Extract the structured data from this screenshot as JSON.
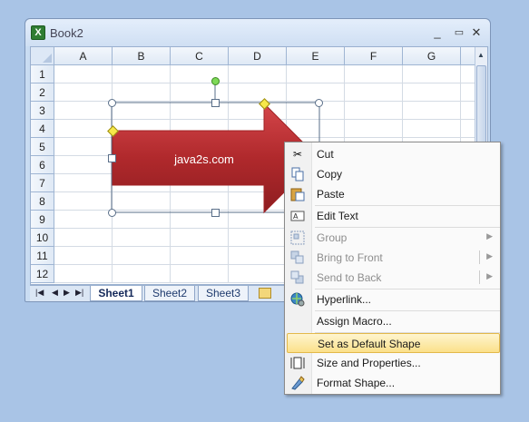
{
  "window": {
    "title": "Book2",
    "minimize": "_",
    "restore": "▭",
    "close": "✕"
  },
  "columns": [
    "A",
    "B",
    "C",
    "D",
    "E",
    "F",
    "G"
  ],
  "rows": [
    "1",
    "2",
    "3",
    "4",
    "5",
    "6",
    "7",
    "8",
    "9",
    "10",
    "11",
    "12"
  ],
  "sheets": {
    "tabs": [
      "Sheet1",
      "Sheet2",
      "Sheet3"
    ],
    "active": "Sheet1"
  },
  "shape": {
    "text": "java2s.com",
    "fill": "#b0292c"
  },
  "menu": {
    "items": [
      {
        "label": "Cut",
        "icon": "scissors-icon",
        "disabled": false
      },
      {
        "label": "Copy",
        "icon": "copy-icon",
        "disabled": false
      },
      {
        "label": "Paste",
        "icon": "paste-icon",
        "disabled": false
      },
      {
        "label": "Edit Text",
        "icon": "edit-text-icon",
        "disabled": false
      },
      {
        "label": "Group",
        "icon": "group-icon",
        "disabled": true
      },
      {
        "label": "Bring to Front",
        "icon": "bring-front-icon",
        "disabled": true
      },
      {
        "label": "Send to Back",
        "icon": "send-back-icon",
        "disabled": true
      },
      {
        "label": "Hyperlink...",
        "icon": "hyperlink-icon",
        "disabled": false
      },
      {
        "label": "Assign Macro...",
        "icon": "",
        "disabled": false
      },
      {
        "label": "Set as Default Shape",
        "icon": "",
        "disabled": false,
        "highlighted": true
      },
      {
        "label": "Size and Properties...",
        "icon": "size-properties-icon",
        "disabled": false
      },
      {
        "label": "Format Shape...",
        "icon": "format-shape-icon",
        "disabled": false
      }
    ]
  },
  "colors": {
    "background": "#a9c4e6",
    "highlight": "#fbe08a"
  }
}
